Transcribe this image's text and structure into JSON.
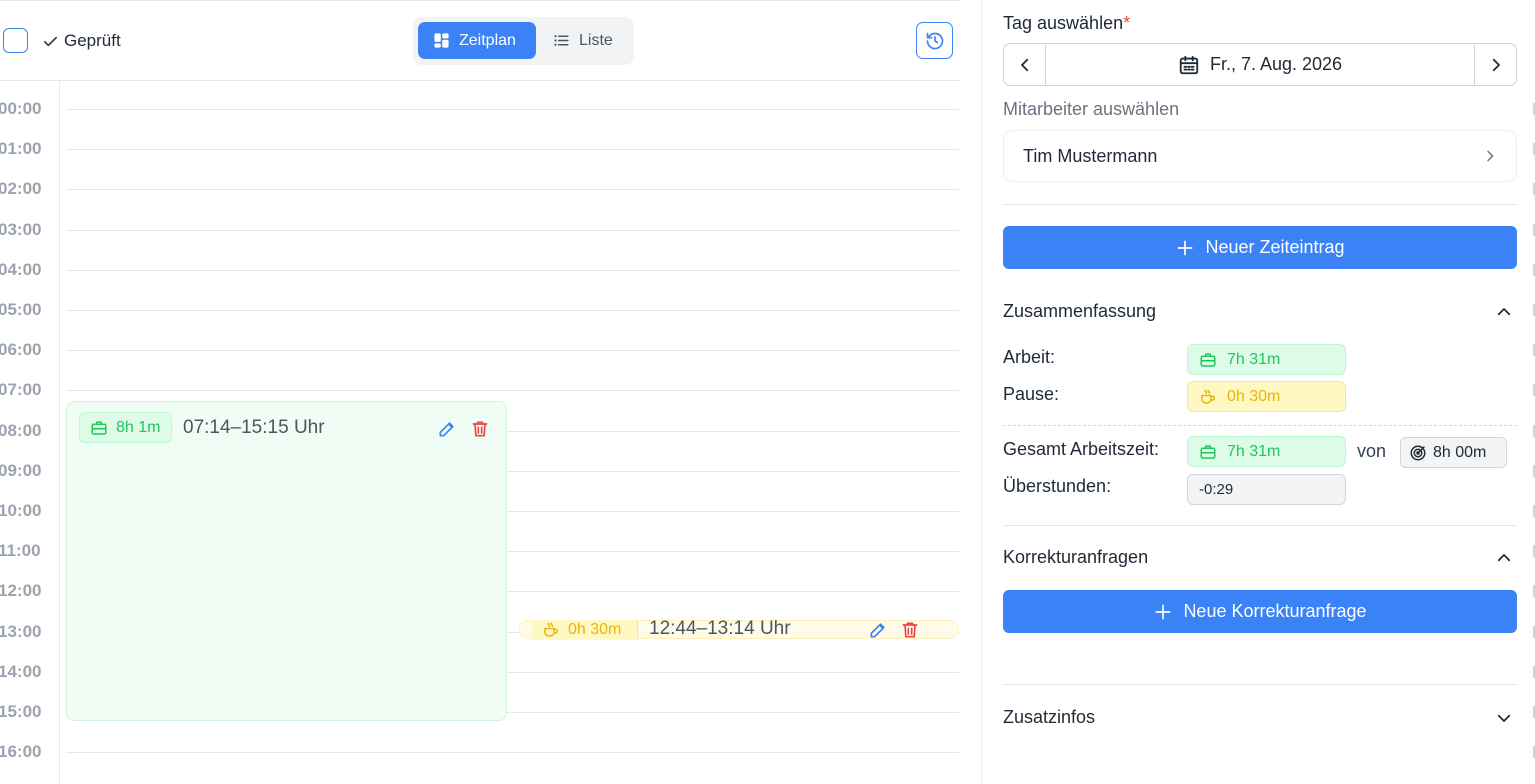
{
  "toolbar": {
    "checked_label": "Geprüft",
    "view_schedule_label": "Zeitplan",
    "view_list_label": "Liste"
  },
  "timeline": {
    "hours": [
      "00:00",
      "01:00",
      "02:00",
      "03:00",
      "04:00",
      "05:00",
      "06:00",
      "07:00",
      "08:00",
      "09:00",
      "10:00",
      "11:00",
      "12:00",
      "13:00",
      "14:00",
      "15:00",
      "16:00"
    ]
  },
  "entries": {
    "work": {
      "duration": "8h 1m",
      "time": "07:14–15:15 Uhr"
    },
    "pause": {
      "duration": "0h 30m",
      "time": "12:44–13:14 Uhr"
    }
  },
  "sidebar": {
    "day_label": "Tag auswählen",
    "required_marker": "*",
    "date_value": "Fr., 7. Aug. 2026",
    "employee_label": "Mitarbeiter auswählen",
    "employee_value": "Tim Mustermann",
    "new_entry_label": "Neuer Zeiteintrag",
    "summary": {
      "title": "Zusammenfassung",
      "work_label": "Arbeit:",
      "work_value": "7h 31m",
      "pause_label": "Pause:",
      "pause_value": "0h 30m",
      "total_label": "Gesamt Arbeitszeit:",
      "total_value": "7h 31m",
      "of_label": "von",
      "target_value": "8h 00m",
      "overtime_label": "Überstunden:",
      "overtime_value": "-0:29"
    },
    "corrections": {
      "title": "Korrekturanfragen",
      "new_request_label": "Neue Korrekturanfrage"
    },
    "extra_info_title": "Zusatzinfos"
  },
  "colors": {
    "accent": "#3b82f6",
    "work_green": "#22c55e",
    "pause_yellow": "#eab308",
    "danger": "#ef4444"
  }
}
